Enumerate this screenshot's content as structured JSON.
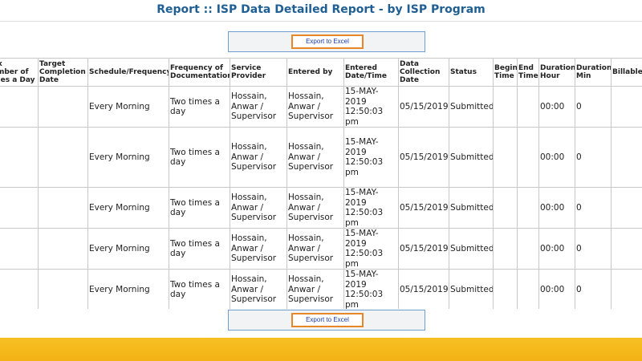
{
  "header": {
    "title": "Report :: ISP Data Detailed Report - by ISP Program"
  },
  "export": {
    "top_label": "Export to Excel",
    "bottom_label": "Export to Excel"
  },
  "table": {
    "columns": [
      "Max Number of Times a Day",
      "Target Completion Date",
      "Schedule/Frequency",
      "Frequency of Documentation",
      "Service Provider",
      "Entered by",
      "Entered Date/Time",
      "Data Collection Date",
      "Status",
      "Begin Time",
      "End Time",
      "Duration Hour",
      "Duration Min",
      "Billable"
    ],
    "rows": [
      {
        "max_times": "",
        "target_date": "",
        "schedule": "Every Morning",
        "frequency_doc": "Two times a day",
        "provider": "Hossain, Anwar / Supervisor",
        "entered_by": "Hossain, Anwar / Supervisor",
        "entered_datetime": "15-MAY-2019 12:50:03 pm",
        "collection_date": "05/15/2019",
        "status": "Submitted",
        "begin": "",
        "end": "",
        "duration_hour": "00:00",
        "duration_min": "0",
        "billable": ""
      },
      {
        "max_times": "",
        "target_date": "",
        "schedule": "Every Morning",
        "frequency_doc": "Two times a day",
        "provider": "Hossain, Anwar / Supervisor",
        "entered_by": "Hossain, Anwar / Supervisor",
        "entered_datetime": "15-MAY-2019 12:50:03 pm",
        "collection_date": "05/15/2019",
        "status": "Submitted",
        "begin": "",
        "end": "",
        "duration_hour": "00:00",
        "duration_min": "0",
        "billable": ""
      },
      {
        "max_times": "",
        "target_date": "",
        "schedule": "Every Morning",
        "frequency_doc": "Two times a day",
        "provider": "Hossain, Anwar / Supervisor",
        "entered_by": "Hossain, Anwar / Supervisor",
        "entered_datetime": "15-MAY-2019 12:50:03 pm",
        "collection_date": "05/15/2019",
        "status": "Submitted",
        "begin": "",
        "end": "",
        "duration_hour": "00:00",
        "duration_min": "0",
        "billable": ""
      },
      {
        "max_times": "",
        "target_date": "",
        "schedule": "Every Morning",
        "frequency_doc": "Two times a day",
        "provider": "Hossain, Anwar / Supervisor",
        "entered_by": "Hossain, Anwar / Supervisor",
        "entered_datetime": "15-MAY-2019 12:50:03 pm",
        "collection_date": "05/15/2019",
        "status": "Submitted",
        "begin": "",
        "end": "",
        "duration_hour": "00:00",
        "duration_min": "0",
        "billable": ""
      },
      {
        "max_times": "",
        "target_date": "",
        "schedule": "Every Morning",
        "frequency_doc": "Two times a day",
        "provider": "Hossain, Anwar / Supervisor",
        "entered_by": "Hossain, Anwar / Supervisor",
        "entered_datetime": "15-MAY-2019 12:50:03 pm",
        "collection_date": "05/15/2019",
        "status": "Submitted",
        "begin": "",
        "end": "",
        "duration_hour": "00:00",
        "duration_min": "0",
        "billable": ""
      }
    ]
  },
  "colors": {
    "title": "#1f5f94",
    "export_border": "#e8862a",
    "export_text": "#1a3da8",
    "footer_band": "#f5b81c"
  }
}
